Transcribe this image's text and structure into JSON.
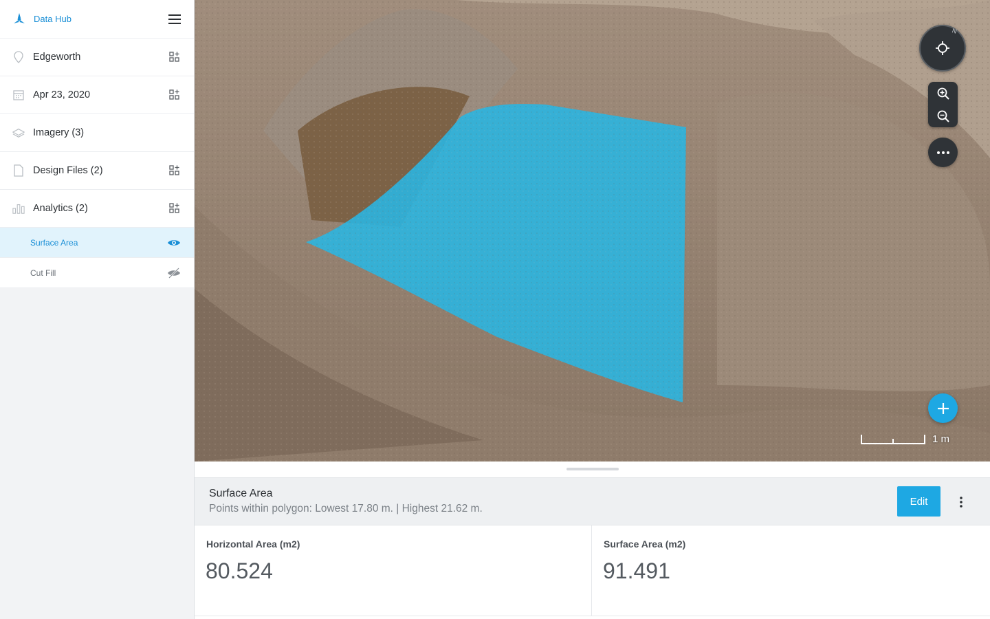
{
  "app": {
    "brand": "Data Hub"
  },
  "sidebar": {
    "items": [
      {
        "label": "Edgeworth",
        "icon": "location-pin-icon",
        "action": "add-widget-icon"
      },
      {
        "label": "Apr 23, 2020",
        "icon": "calendar-icon",
        "action": "add-widget-icon"
      },
      {
        "label": "Imagery (3)",
        "icon": "layers-icon",
        "action": ""
      },
      {
        "label": "Design Files (2)",
        "icon": "file-icon",
        "action": "add-widget-icon"
      },
      {
        "label": "Analytics (2)",
        "icon": "bar-chart-icon",
        "action": "add-widget-icon"
      }
    ],
    "analytics_children": [
      {
        "label": "Surface Area",
        "visible": true
      },
      {
        "label": "Cut Fill",
        "visible": false
      }
    ]
  },
  "map": {
    "compass_label": "N",
    "scale_label": "1 m",
    "colors": {
      "overlay": "#2bb5e0",
      "controls": "#2f3337",
      "accent": "#1ea8e3"
    }
  },
  "panel": {
    "title": "Surface Area",
    "subtitle": "Points within polygon: Lowest 17.80 m. | Highest 21.62 m.",
    "edit_label": "Edit",
    "metrics": [
      {
        "label": "Horizontal Area (m2)",
        "value": "80.524"
      },
      {
        "label": "Surface Area (m2)",
        "value": "91.491"
      }
    ]
  }
}
